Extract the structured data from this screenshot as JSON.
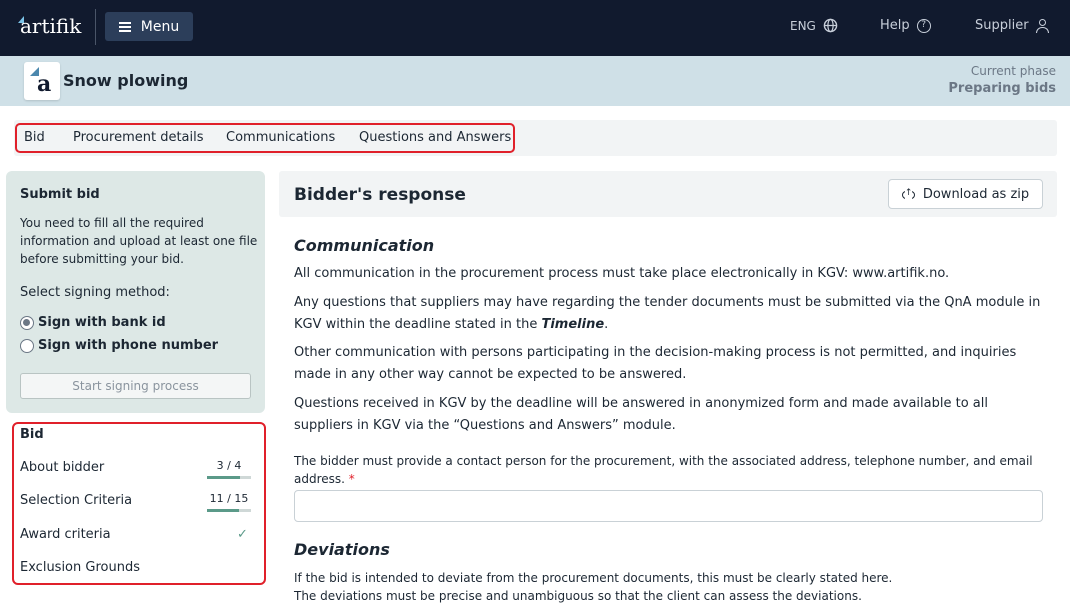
{
  "topbar": {
    "logo": "artifik",
    "menu_label": "Menu",
    "language": "ENG",
    "help": "Help",
    "help_icon_glyph": "?",
    "user": "Supplier"
  },
  "project": {
    "icon_letter": "a",
    "title": "Snow plowing",
    "phase_label": "Current phase",
    "phase_value": "Preparing bids"
  },
  "tabs": [
    {
      "label": "Bid"
    },
    {
      "label": "Procurement details"
    },
    {
      "label": "Communications"
    },
    {
      "label": "Questions and Answers"
    }
  ],
  "submit": {
    "title": "Submit bid",
    "description": "You need to fill all the required information and upload at least one file before submitting your bid.",
    "signing_label": "Select signing method:",
    "options": [
      {
        "label": "Sign with bank id",
        "selected": true
      },
      {
        "label": "Sign with phone number",
        "selected": false
      }
    ],
    "start_button": "Start signing process"
  },
  "bid": {
    "title": "Bid",
    "items": [
      {
        "label": "About bidder",
        "progress": "3 / 4",
        "fraction": 0.75
      },
      {
        "label": "Selection Criteria",
        "progress": "11 / 15",
        "fraction": 0.733
      },
      {
        "label": "Award criteria",
        "complete": true
      },
      {
        "label": "Exclusion Grounds"
      }
    ]
  },
  "main": {
    "title": "Bidder's response",
    "download_button": "Download as zip",
    "communication": {
      "heading": "Communication",
      "p1": "All communication in the procurement process must take place electronically in KGV: www.artifik.no.",
      "p2_before": "Any questions that suppliers may have regarding the tender documents must be submitted via the QnA module in KGV within the deadline stated in the ",
      "p2_emph": "Timeline",
      "p2_after": ".",
      "p3": "Other communication with persons participating in the decision-making process is not permitted, and inquiries made in any other way cannot be expected to be answered.",
      "p4": "Questions received in KGV by the deadline will be answered in anonymized form and made available to all suppliers in KGV via the “Questions and Answers” module."
    },
    "contact_label": "The bidder must provide a contact person for the procurement, with the associated address, telephone number, and email address.",
    "required_marker": "*",
    "contact_value": "",
    "deviations": {
      "heading": "Deviations",
      "line1": "If the bid is intended to deviate from the procurement documents, this must be clearly stated here.",
      "line2": "The deviations must be precise and unambiguous so that the client can assess the deviations."
    }
  },
  "colors": {
    "topbar": "#111a2e",
    "project_bar": "#cfe0e7",
    "sidebar_card": "#dde8e6",
    "highlight": "#e0202a",
    "progress": "#5b9a89"
  }
}
